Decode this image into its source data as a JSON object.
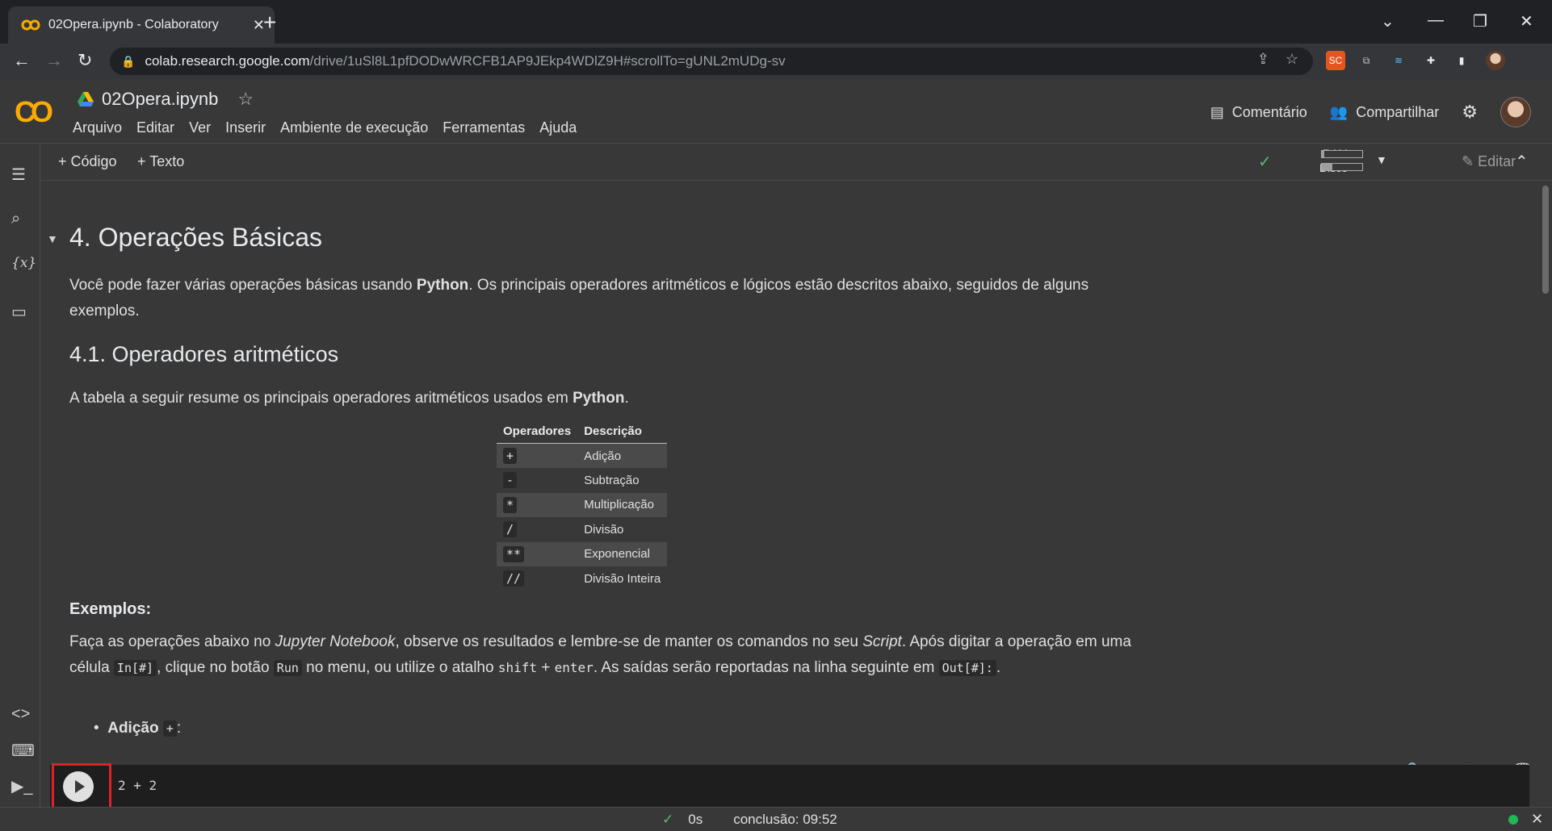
{
  "browser": {
    "tab_title": "02Opera.ipynb - Colaboratory",
    "url_host": "colab.research.google.com",
    "url_path": "/drive/1uSl8L1pfDODwWRCFB1AP9JEkp4WDlZ9H#scrollTo=gUNL2mUDg-sv",
    "ext_label": "SC"
  },
  "colab": {
    "logo": "CO",
    "notebook_name": "02Opera.ipynb",
    "menu": [
      "Arquivo",
      "Editar",
      "Ver",
      "Inserir",
      "Ambiente de execução",
      "Ferramentas",
      "Ajuda"
    ],
    "comment_label": "Comentário",
    "share_label": "Compartilhar",
    "add_code_label": "Código",
    "add_text_label": "Texto",
    "ram_label": "RAM",
    "disk_label": "Disco",
    "ram_level": 0.05,
    "disk_level": 0.25,
    "edit_label": "Editar"
  },
  "notebook": {
    "h1": "4. Operações Básicas",
    "intro_pre": "Você pode fazer várias operações básicas usando ",
    "intro_bold": "Python",
    "intro_post": ". Os principais operadores aritméticos e lógicos estão descritos abaixo, seguidos de alguns exemplos.",
    "h2": "4.1. Operadores aritméticos",
    "table_intro_pre": "A tabela a seguir resume os principais operadores aritméticos usados em ",
    "table_intro_bold": "Python",
    "table_intro_post": ".",
    "table_headers": [
      "Operadores",
      "Descrição"
    ],
    "table_rows": [
      {
        "op": "+",
        "desc": "Adição"
      },
      {
        "op": "-",
        "desc": "Subtração"
      },
      {
        "op": "*",
        "desc": "Multiplicação"
      },
      {
        "op": "/",
        "desc": "Divisão"
      },
      {
        "op": "**",
        "desc": "Exponencial"
      },
      {
        "op": "//",
        "desc": "Divisão Inteira"
      }
    ],
    "examples_heading": "Exemplos:",
    "ex_p1": "Faça as operações abaixo no ",
    "ex_i1": "Jupyter Notebook",
    "ex_p2": ", observe os resultados e lembre-se de manter os comandos no seu ",
    "ex_i2": "Script",
    "ex_p3": ". Após digitar a operação em uma célula ",
    "ex_c1": "In[#]",
    "ex_p4": ", clique no botão ",
    "ex_c2": "Run",
    "ex_p5": " no menu, ou utilize o atalho ",
    "ex_k1": "shift",
    "ex_p6": " + ",
    "ex_k2": "enter",
    "ex_p7": ". As saídas serão reportadas na linha seguinte em ",
    "ex_c3": "Out[#]:",
    "ex_p8": ".",
    "bullet_bold": "Adição",
    "bullet_code": "+",
    "bullet_colon": ":",
    "code": "2 + 2"
  },
  "status": {
    "time": "0s",
    "completion": "conclusão: 09:52"
  }
}
